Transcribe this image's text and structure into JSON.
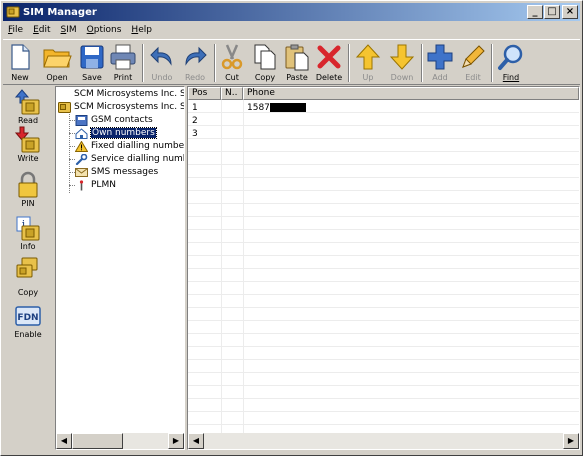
{
  "window": {
    "title": "SIM Manager",
    "minimize": "_",
    "maximize": "□",
    "close": "×"
  },
  "menu": [
    {
      "ul": "F",
      "rest": "ile"
    },
    {
      "ul": "E",
      "rest": "dit"
    },
    {
      "ul": "S",
      "rest": "IM"
    },
    {
      "ul": "O",
      "rest": "ptions"
    },
    {
      "ul": "H",
      "rest": "elp"
    }
  ],
  "toolbar": {
    "new": "New",
    "open": "Open",
    "save": "Save",
    "print": "Print",
    "undo": "Undo",
    "redo": "Redo",
    "cut": "Cut",
    "copy": "Copy",
    "paste": "Paste",
    "delete": "Delete",
    "up": "Up",
    "down": "Down",
    "add": "Add",
    "edit": "Edit",
    "find": "Find"
  },
  "sidebar": {
    "read": "Read",
    "write": "Write",
    "pin": "PIN",
    "info": "Info",
    "copy": "Copy",
    "fdn_badge": "FDN",
    "enable": "Enable"
  },
  "tree": {
    "items": [
      "SCM Microsystems Inc. SDIO",
      "SCM Microsystems Inc. SDIO",
      "GSM contacts",
      "Own numbers",
      "Fixed dialling numbers",
      "Service dialling numbers",
      "SMS messages",
      "PLMN"
    ]
  },
  "table": {
    "headers": [
      "Pos",
      "N..",
      "Phone"
    ],
    "rows": [
      {
        "pos": "1",
        "n": "",
        "phone": "1587"
      },
      {
        "pos": "2",
        "n": "",
        "phone": ""
      },
      {
        "pos": "3",
        "n": "",
        "phone": ""
      }
    ]
  },
  "colors": {
    "title_gradient_start": "#0a246a",
    "title_gradient_end": "#a6caf0",
    "face": "#d4d0c8",
    "selection": "#0a246a"
  }
}
